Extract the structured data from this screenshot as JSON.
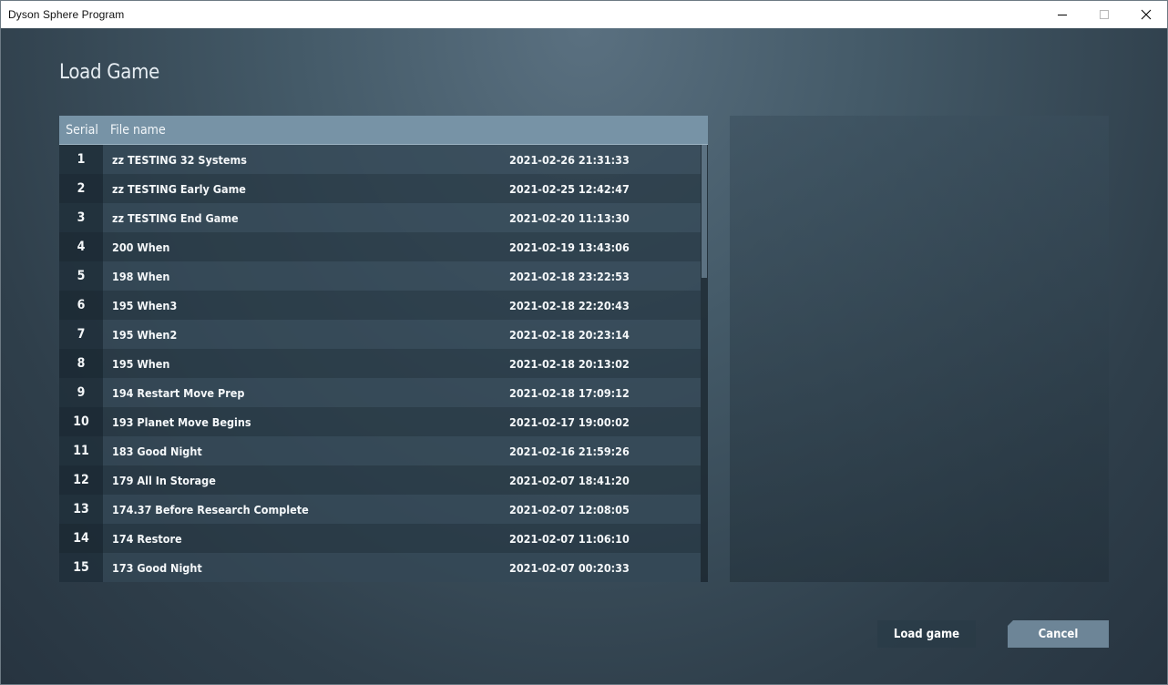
{
  "window": {
    "title": "Dyson Sphere Program"
  },
  "page": {
    "title": "Load Game"
  },
  "list": {
    "headers": {
      "serial": "Serial",
      "file_name": "File name"
    },
    "rows": [
      {
        "serial": "1",
        "name": "zz TESTING 32 Systems",
        "date": "2021-02-26 21:31:33"
      },
      {
        "serial": "2",
        "name": "zz TESTING Early Game",
        "date": "2021-02-25 12:42:47"
      },
      {
        "serial": "3",
        "name": "zz TESTING End Game",
        "date": "2021-02-20 11:13:30"
      },
      {
        "serial": "4",
        "name": "200 When",
        "date": "2021-02-19 13:43:06"
      },
      {
        "serial": "5",
        "name": "198 When",
        "date": "2021-02-18 23:22:53"
      },
      {
        "serial": "6",
        "name": "195 When3",
        "date": "2021-02-18 22:20:43"
      },
      {
        "serial": "7",
        "name": "195 When2",
        "date": "2021-02-18 20:23:14"
      },
      {
        "serial": "8",
        "name": "195 When",
        "date": "2021-02-18 20:13:02"
      },
      {
        "serial": "9",
        "name": "194 Restart Move Prep",
        "date": "2021-02-18 17:09:12"
      },
      {
        "serial": "10",
        "name": "193 Planet Move Begins",
        "date": "2021-02-17 19:00:02"
      },
      {
        "serial": "11",
        "name": "183 Good Night",
        "date": "2021-02-16 21:59:26"
      },
      {
        "serial": "12",
        "name": "179 All In Storage",
        "date": "2021-02-07 18:41:20"
      },
      {
        "serial": "13",
        "name": "174.37 Before Research Complete",
        "date": "2021-02-07 12:08:05"
      },
      {
        "serial": "14",
        "name": "174 Restore",
        "date": "2021-02-07 11:06:10"
      },
      {
        "serial": "15",
        "name": "173 Good Night",
        "date": "2021-02-07 00:20:33"
      }
    ]
  },
  "buttons": {
    "load": "Load game",
    "cancel": "Cancel"
  },
  "icons": {
    "minimize": "minimize-icon",
    "maximize": "maximize-icon",
    "close": "close-icon"
  }
}
